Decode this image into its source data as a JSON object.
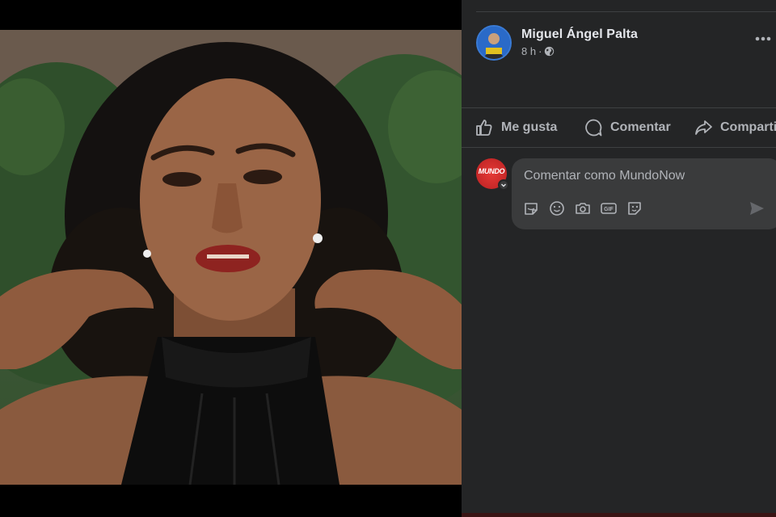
{
  "post": {
    "author_name": "Miguel Ángel Palta",
    "time": "8 h",
    "separator": "·",
    "audience_icon": "globe-icon"
  },
  "actions": {
    "like_label": "Me gusta",
    "comment_label": "Comentar",
    "share_label": "Compartir"
  },
  "composer": {
    "placeholder": "Comentar como MundoNow",
    "page_avatar_text": "MUNDO",
    "tools": [
      "sticker-icon",
      "emoji-icon",
      "camera-icon",
      "gif-icon",
      "avatar-sticker-icon"
    ],
    "gif_label": "GIF"
  },
  "colors": {
    "panel_bg": "#242526",
    "text_primary": "#e4e6eb",
    "text_secondary": "#b0b3b8",
    "input_bg": "#3a3b3c",
    "brand_red": "#e53935"
  }
}
